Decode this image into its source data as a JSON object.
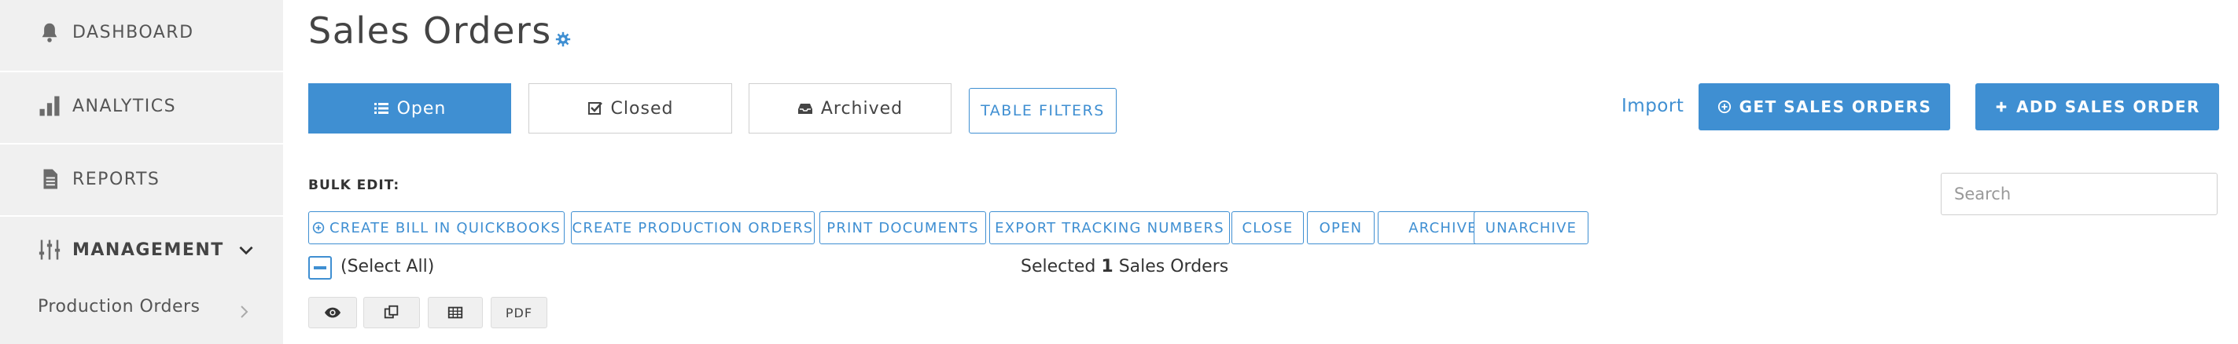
{
  "sidebar": {
    "items": [
      {
        "label": "DASHBOARD",
        "icon": "bell-icon"
      },
      {
        "label": "ANALYTICS",
        "icon": "bar-chart-icon"
      },
      {
        "label": "REPORTS",
        "icon": "document-icon"
      },
      {
        "label": "MANAGEMENT",
        "icon": "sliders-icon"
      }
    ],
    "sub_items": [
      {
        "label": "Production Orders"
      }
    ]
  },
  "page": {
    "title": "Sales Orders"
  },
  "tabs": [
    {
      "label": "Open",
      "icon": "list-icon",
      "active": true
    },
    {
      "label": "Closed",
      "icon": "checkbox-icon",
      "active": false
    },
    {
      "label": "Archived",
      "icon": "inbox-icon",
      "active": false
    }
  ],
  "toolbar": {
    "filters_label": "TABLE FILTERS",
    "import_label": "Import",
    "get_orders_label": "GET SALES ORDERS",
    "add_order_label": "ADD SALES ORDER"
  },
  "bulk_edit": {
    "label": "BULK EDIT:",
    "actions": [
      {
        "label": "CREATE BILL IN QUICKBOOKS",
        "icon": "plus-circle-icon"
      },
      {
        "label": "CREATE PRODUCTION ORDERS"
      },
      {
        "label": "PRINT DOCUMENTS"
      },
      {
        "label": "EXPORT TRACKING NUMBERS"
      },
      {
        "label": "CLOSE"
      },
      {
        "label": "OPEN"
      },
      {
        "label": "ARCHIVE"
      },
      {
        "label": "UNARCHIVE"
      }
    ]
  },
  "search": {
    "placeholder": "Search",
    "value": ""
  },
  "selection": {
    "select_all_label": "(Select All)",
    "selected_prefix": "Selected",
    "selected_count": "1",
    "selected_suffix": "Sales Orders"
  },
  "view_buttons": {
    "pdf_label": "PDF"
  },
  "colors": {
    "accent": "#3f8fd2",
    "sidebar_bg": "#f0f0f0"
  }
}
